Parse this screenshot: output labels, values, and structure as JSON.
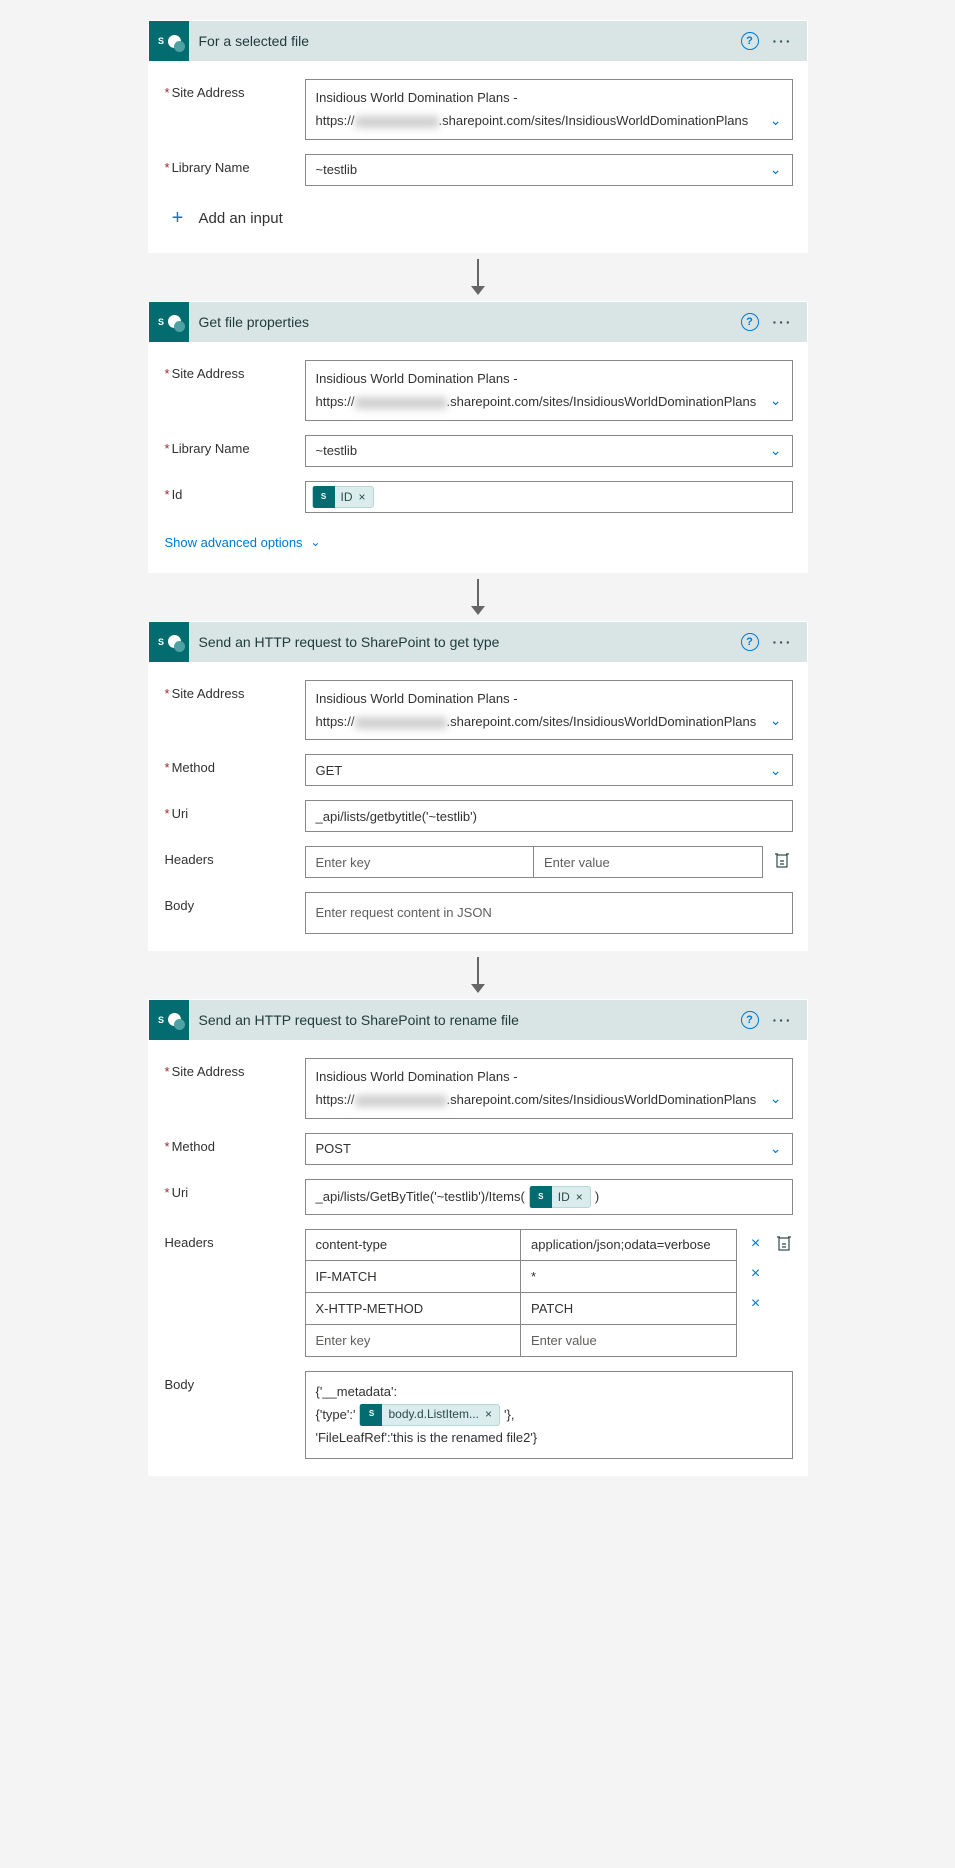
{
  "cards": {
    "selectedFile": {
      "title": "For a selected file",
      "siteLabel": "Site Address",
      "siteLine1": "Insidious World Domination Plans -",
      "sitePrefix": "https://",
      "siteSuffix": ".sharepoint.com/sites/InsidiousWorldDominationPlans",
      "libraryLabel": "Library Name",
      "library": "~testlib",
      "addInput": "Add an input"
    },
    "getProps": {
      "title": "Get file properties",
      "siteLabel": "Site Address",
      "siteLine1": "Insidious World Domination Plans -",
      "sitePrefix": "https://",
      "siteSuffix": ".sharepoint.com/sites/InsidiousWorldDominationPlans",
      "libraryLabel": "Library Name",
      "library": "~testlib",
      "idLabel": "Id",
      "idToken": "ID",
      "advanced": "Show advanced options"
    },
    "httpGet": {
      "title": "Send an HTTP request to SharePoint to get type",
      "siteLabel": "Site Address",
      "siteLine1": "Insidious World Domination Plans -",
      "sitePrefix": "https://",
      "siteSuffix": ".sharepoint.com/sites/InsidiousWorldDominationPlans",
      "methodLabel": "Method",
      "method": "GET",
      "uriLabel": "Uri",
      "uri": "_api/lists/getbytitle('~testlib')",
      "headersLabel": "Headers",
      "headersKeyPh": "Enter key",
      "headersValPh": "Enter value",
      "bodyLabel": "Body",
      "bodyPh": "Enter request content in JSON"
    },
    "httpPost": {
      "title": "Send an HTTP request to SharePoint to rename file",
      "siteLabel": "Site Address",
      "siteLine1": "Insidious World Domination Plans -",
      "sitePrefix": "https://",
      "siteSuffix": ".sharepoint.com/sites/InsidiousWorldDominationPlans",
      "methodLabel": "Method",
      "method": "POST",
      "uriLabel": "Uri",
      "uriPrefix": "_api/lists/GetByTitle('~testlib')/Items(",
      "uriToken": "ID",
      "uriSuffix": ")",
      "headersLabel": "Headers",
      "headers": [
        {
          "k": "content-type",
          "v": "application/json;odata=verbose"
        },
        {
          "k": "IF-MATCH",
          "v": "*"
        },
        {
          "k": "X-HTTP-METHOD",
          "v": "PATCH"
        }
      ],
      "headersKeyPh": "Enter key",
      "headersValPh": "Enter value",
      "bodyLabel": "Body",
      "bodyLine1": "{'__metadata':",
      "bodyLine2a": "{'type':'",
      "bodyToken": "body.d.ListItem...",
      "bodyLine2b": "'},",
      "bodyLine3": "'FileLeafRef':'this is the renamed file2'}"
    }
  }
}
